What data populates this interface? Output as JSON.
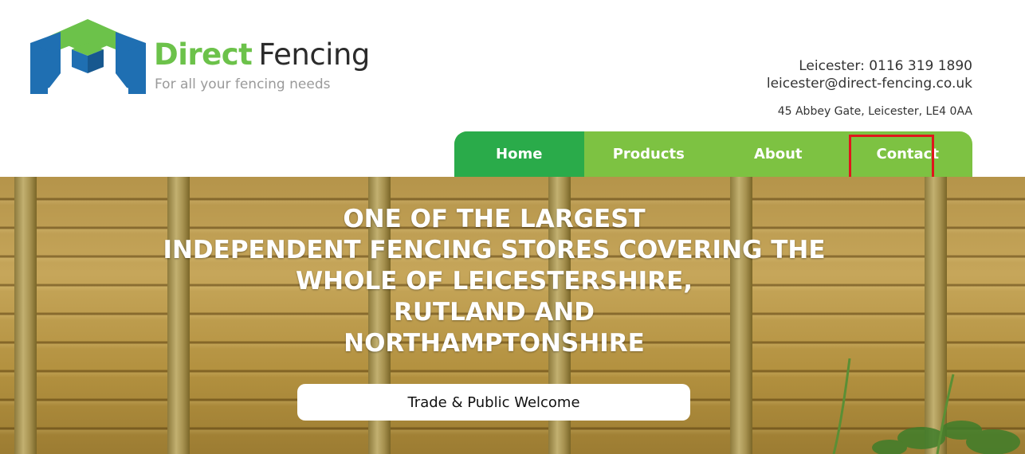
{
  "brand": {
    "name_part1": "Direct",
    "name_part2": "Fencing",
    "tagline": "For all your fencing needs",
    "logo_icon": "cube-logo-icon",
    "colors": {
      "green": "#6cc24a",
      "blue": "#1f6fb2",
      "dark_text": "#2b2b2b"
    }
  },
  "contact": {
    "phone": "Leicester: 0116 319 1890",
    "email": "leicester@direct-fencing.co.uk",
    "address": "45 Abbey Gate, Leicester, LE4 0AA"
  },
  "nav": {
    "items": [
      {
        "label": "Home",
        "active": true
      },
      {
        "label": "Products",
        "active": false
      },
      {
        "label": "About",
        "active": false
      },
      {
        "label": "Contact",
        "active": false,
        "highlighted": true
      }
    ],
    "colors": {
      "bar": "#7dc242",
      "active": "#2aab4a",
      "highlight_border": "#e0161c"
    }
  },
  "hero": {
    "title_lines": [
      "ONE OF THE LARGEST",
      "INDEPENDENT FENCING STORES COVERING THE",
      "WHOLE OF LEICESTERSHIRE,",
      "RUTLAND AND",
      "NORTHAMPTONSHIRE"
    ],
    "button_label": "Trade & Public Welcome",
    "background": "wooden-fence-panel-image"
  }
}
